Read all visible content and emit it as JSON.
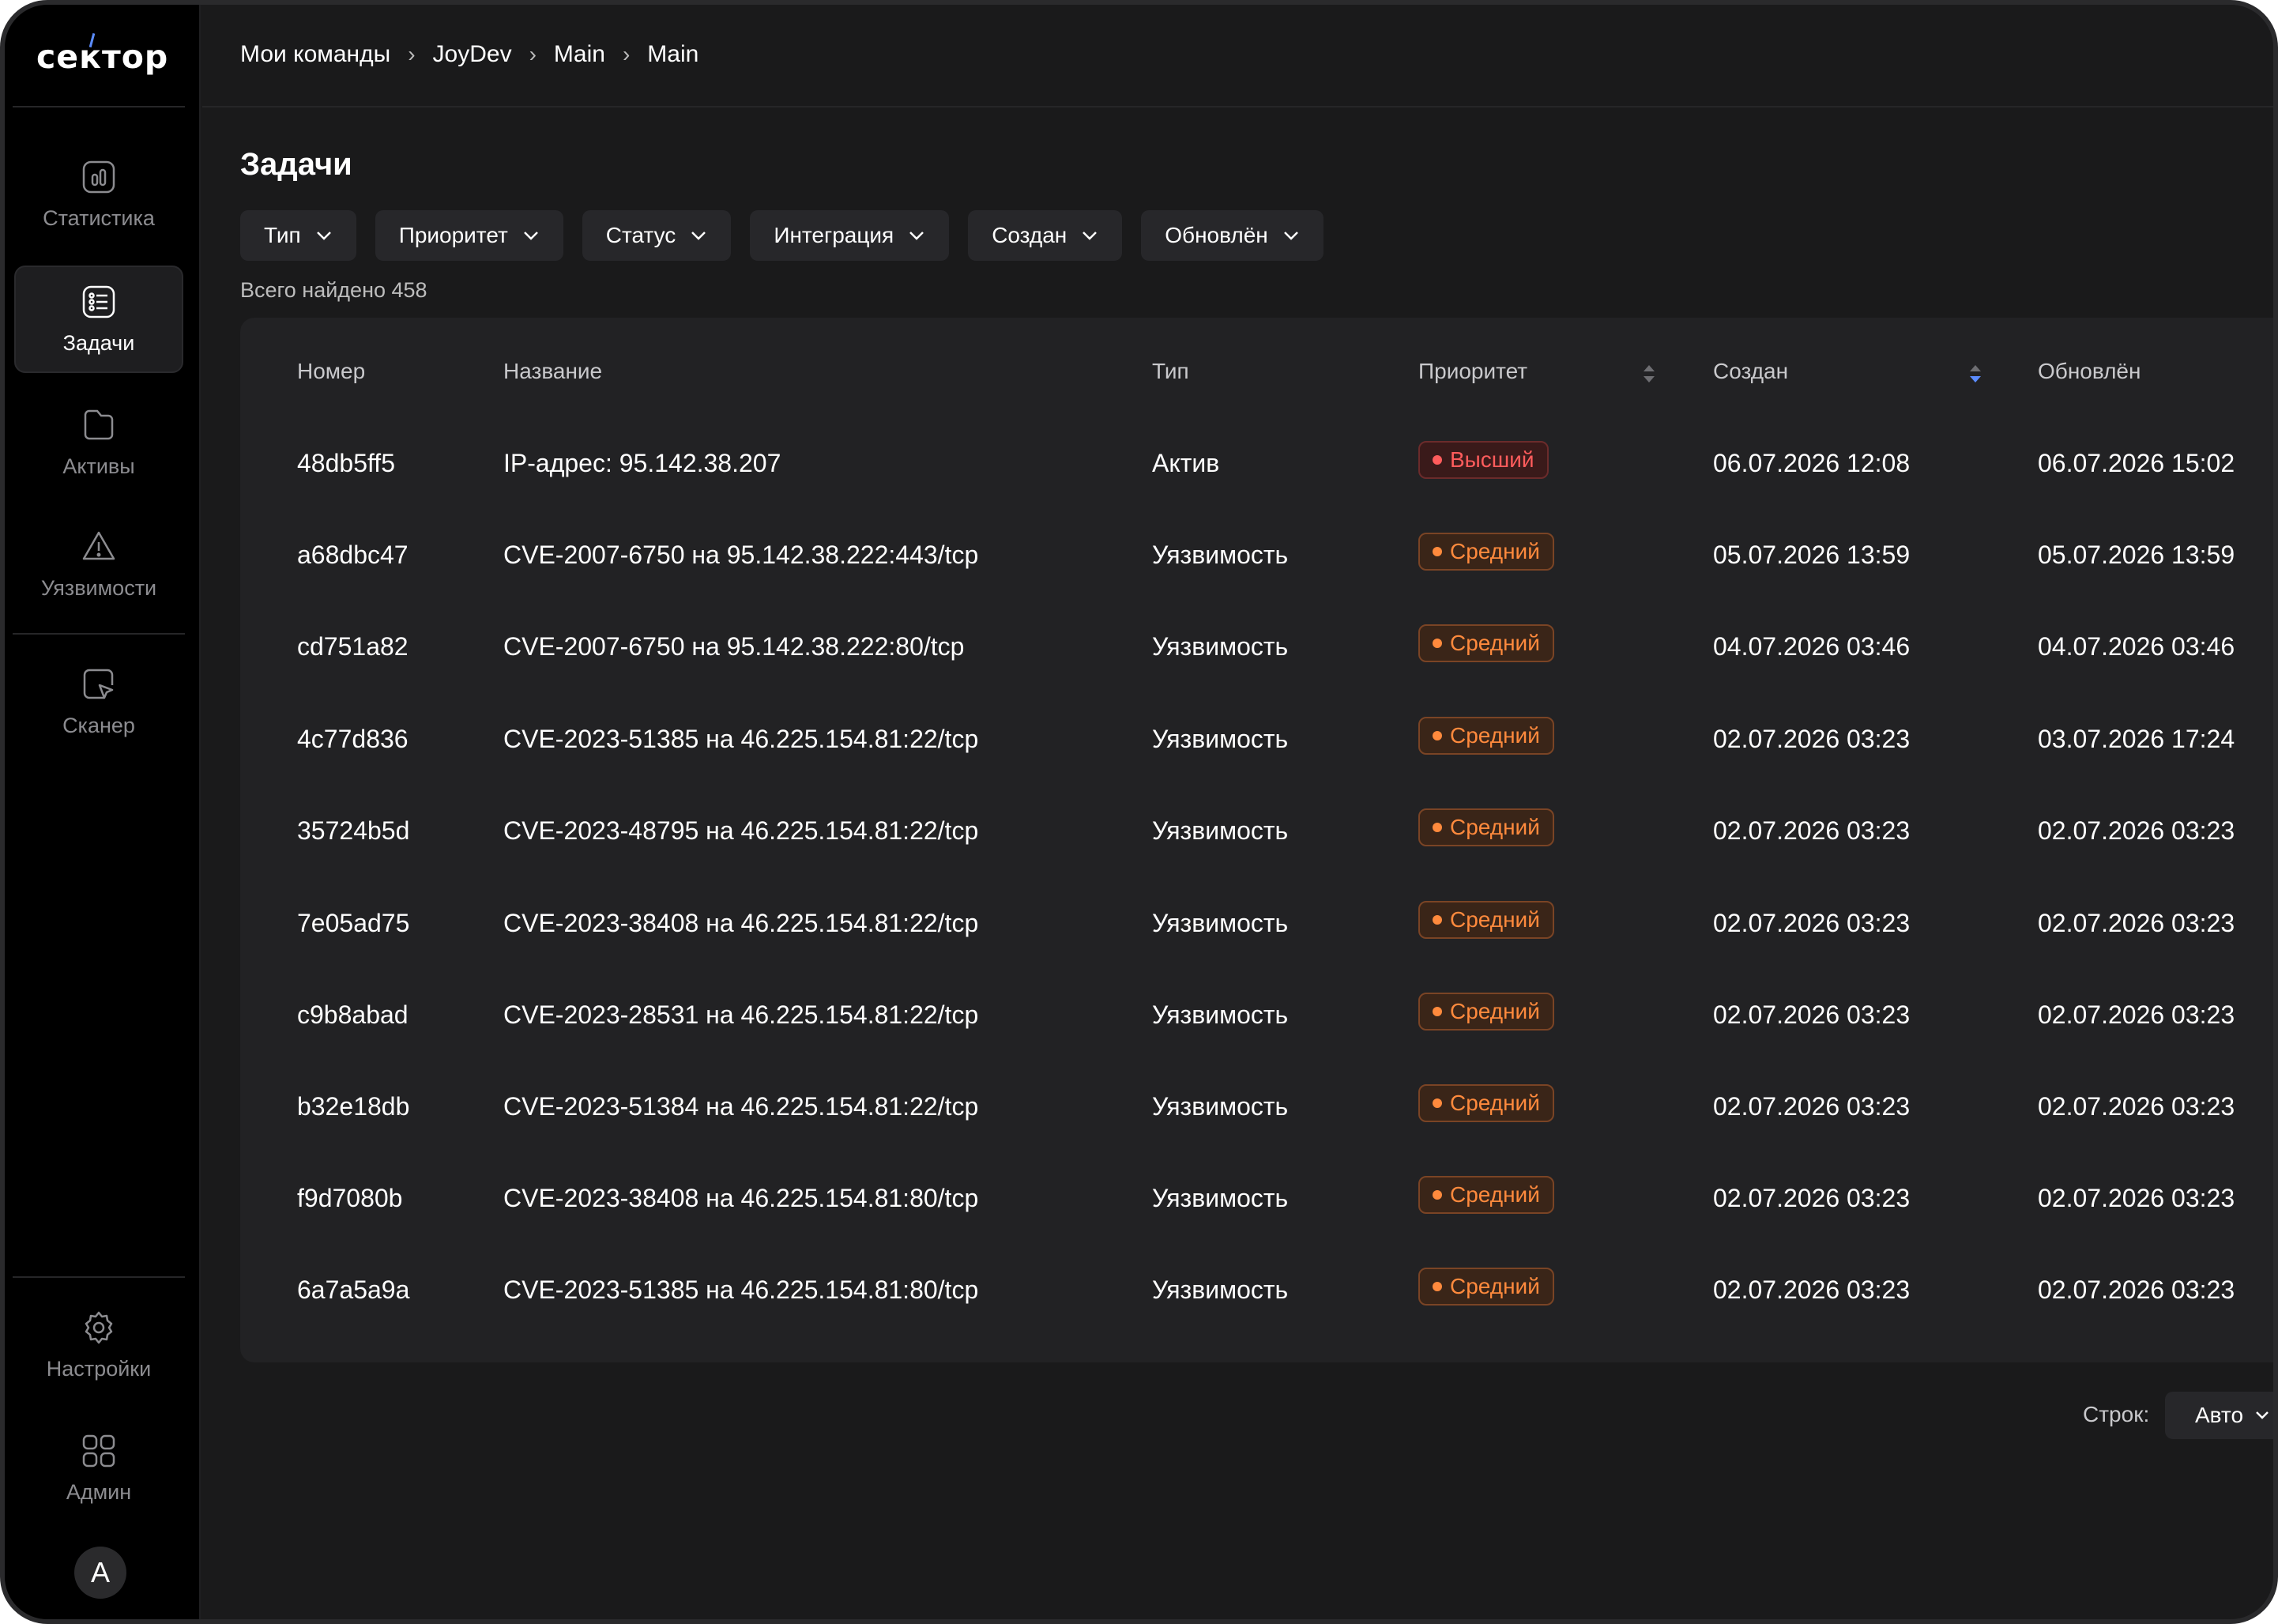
{
  "app": {
    "logo": "сектор"
  },
  "sidebar": {
    "items": [
      {
        "label": "Статистика",
        "icon": "chart-icon"
      },
      {
        "label": "Задачи",
        "icon": "tasks-icon",
        "active": true
      },
      {
        "label": "Активы",
        "icon": "folder-icon"
      },
      {
        "label": "Уязвимости",
        "icon": "warning-icon"
      },
      {
        "label": "Сканер",
        "icon": "scanner-icon"
      }
    ],
    "bottom_items": [
      {
        "label": "Настройки",
        "icon": "gear-icon"
      },
      {
        "label": "Админ",
        "icon": "grid-icon"
      }
    ],
    "avatar_letter": "A"
  },
  "breadcrumb": [
    "Мои команды",
    "JoyDev",
    "Main",
    "Main"
  ],
  "page": {
    "title": "Задачи",
    "filters": [
      "Тип",
      "Приоритет",
      "Статус",
      "Интеграция",
      "Создан",
      "Обновлён"
    ],
    "found": "Всего найдено 458"
  },
  "table": {
    "columns": [
      "Номер",
      "Название",
      "Тип",
      "Приоритет",
      "Создан",
      "Обновлён"
    ],
    "rows": [
      {
        "id": "48db5ff5",
        "name": "IP-адрес: 95.142.38.207",
        "type": "Актив",
        "priority": "Высший",
        "created": "06.07.2026 12:08",
        "updated": "06.07.2026 15:02"
      },
      {
        "id": "a68dbc47",
        "name": "CVE-2007-6750 на 95.142.38.222:443/tcp",
        "type": "Уязвимость",
        "priority": "Средний",
        "created": "05.07.2026 13:59",
        "updated": "05.07.2026 13:59"
      },
      {
        "id": "cd751a82",
        "name": "CVE-2007-6750 на 95.142.38.222:80/tcp",
        "type": "Уязвимость",
        "priority": "Средний",
        "created": "04.07.2026 03:46",
        "updated": "04.07.2026 03:46"
      },
      {
        "id": "4c77d836",
        "name": "CVE-2023-51385 на 46.225.154.81:22/tcp",
        "type": "Уязвимость",
        "priority": "Средний",
        "created": "02.07.2026 03:23",
        "updated": "03.07.2026 17:24"
      },
      {
        "id": "35724b5d",
        "name": "CVE-2023-48795 на 46.225.154.81:22/tcp",
        "type": "Уязвимость",
        "priority": "Средний",
        "created": "02.07.2026 03:23",
        "updated": "02.07.2026 03:23"
      },
      {
        "id": "7e05ad75",
        "name": "CVE-2023-38408 на 46.225.154.81:22/tcp",
        "type": "Уязвимость",
        "priority": "Средний",
        "created": "02.07.2026 03:23",
        "updated": "02.07.2026 03:23"
      },
      {
        "id": "c9b8abad",
        "name": "CVE-2023-28531 на 46.225.154.81:22/tcp",
        "type": "Уязвимость",
        "priority": "Средний",
        "created": "02.07.2026 03:23",
        "updated": "02.07.2026 03:23"
      },
      {
        "id": "b32e18db",
        "name": "CVE-2023-51384 на 46.225.154.81:22/tcp",
        "type": "Уязвимость",
        "priority": "Средний",
        "created": "02.07.2026 03:23",
        "updated": "02.07.2026 03:23"
      },
      {
        "id": "f9d7080b",
        "name": "CVE-2023-38408 на 46.225.154.81:80/tcp",
        "type": "Уязвимость",
        "priority": "Средний",
        "created": "02.07.2026 03:23",
        "updated": "02.07.2026 03:23"
      },
      {
        "id": "6a7a5a9a",
        "name": "CVE-2023-51385 на 46.225.154.81:80/tcp",
        "type": "Уязвимость",
        "priority": "Средний",
        "created": "02.07.2026 03:23",
        "updated": "02.07.2026 03:23"
      }
    ]
  },
  "pagination": {
    "rows_label": "Строк:",
    "rows_value": "Авто"
  },
  "colors": {
    "background": "#1a1a1b",
    "sidebar": "#000000",
    "accent": "#5b8cff",
    "priority_high": "#ff5c5c",
    "priority_medium": "#ff8a3d"
  }
}
